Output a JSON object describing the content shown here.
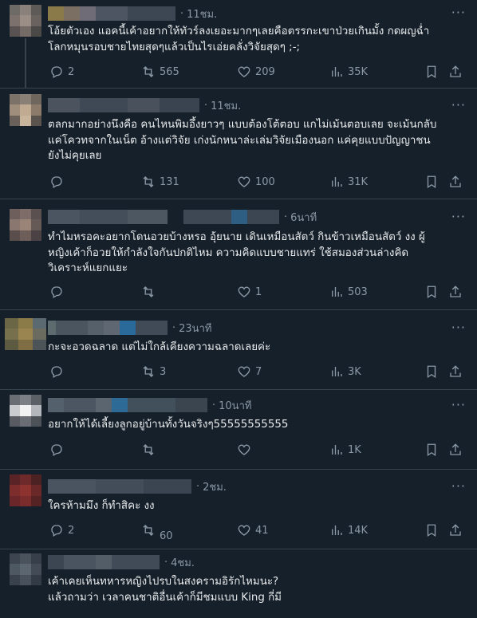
{
  "ui": {
    "more_label": "···"
  },
  "tweets": [
    {
      "time": "11ชม.",
      "text": "โอ้ยตัวเอง แอคนี้เค้าอยากให้ทัวร์ลงเยอะมากๆเลยคือตรรกะเขาป่วยเกินมั้ง กดผญฉ่ำ\nโลกหมุนรอบชายไทยสุดๆแล้วเป็นไรเอ่ยคลั่งวิจัยสุดๆ ;-;",
      "replies": "2",
      "retweets": "565",
      "likes": "209",
      "views": "35K"
    },
    {
      "time": "11ชม.",
      "text": "ตลกมากอย่างนึงคือ คนไหนพิมอึ้งยาวๆ แบบต้องโต้ตอบ แกไม่เม้นตอบเลย จะเม้นกลับ\nแค่โควทจากในเน็ต อ้างแต่วิจัย เก่งนักหนาล่ะเล่มวิจัยเมืองนอก แค่คุยแบบปัญญาชน\nยังไม่คุยเลย",
      "replies": "",
      "retweets": "131",
      "likes": "100",
      "views": "31K"
    },
    {
      "time": "6นาที",
      "text": "ทำไมหรอคะอยากโดนอวยบ้างหรอ อุ้ยนาย เดินเหมือนสัตว์ กินข้าวเหมือนสัตว์ งง ผู้\nหญิงเค้าก็อวยให้กำลังใจกันปกติไหม ความคิดแบบชายแทร่ ใช้สมองส่วนล่างคิด\nวิเคราะห์แยกแยะ",
      "replies": "",
      "retweets": "",
      "likes": "1",
      "views": "503"
    },
    {
      "time": "23นาที",
      "text": "กะจะอวดฉลาด แต่ไม่ใกล้เคียงความฉลาดเลยค่ะ",
      "replies": "",
      "retweets": "3",
      "likes": "7",
      "views": "3K"
    },
    {
      "time": "10นาที",
      "text": "อยากให้ได้เลี้ยงลูกอยู่บ้านทั้งวันจริงๆ55555555555",
      "replies": "",
      "retweets": "",
      "likes": "",
      "views": "1K"
    },
    {
      "time": "2ชม.",
      "text": "ใครห้ามมึง ก็ทำสิคะ งง",
      "replies": "2",
      "retweets": "60",
      "likes": "41",
      "views": "14K"
    },
    {
      "time": "4ชม.",
      "text": "เค้าเคยเห็นทหารหญิงไปรบในสงครามอิรักไหมนะ?\nแล้วถามว่า เวลาคนชาติอื่นเค้าก็มีชมแบบ King กี่มี",
      "replies": "",
      "retweets": "",
      "likes": "",
      "views": ""
    }
  ]
}
